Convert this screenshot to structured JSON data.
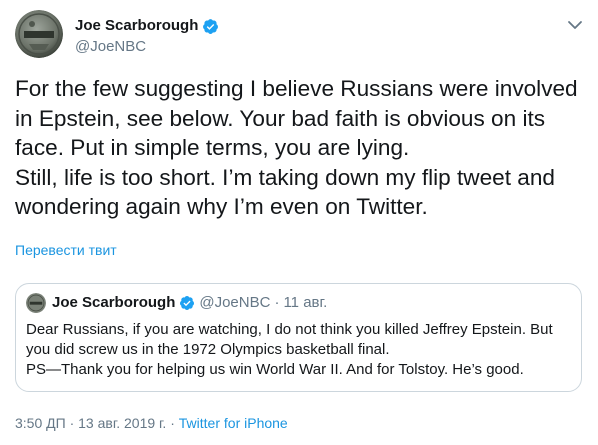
{
  "author": {
    "name": "Joe Scarborough",
    "handle": "@JoeNBC"
  },
  "tweet": {
    "lines": [
      "For the few suggesting I believe Russians were involved",
      "in Epstein, see below. Your bad faith is obvious on its",
      "face. Put in simple terms, you are lying.",
      "Still, life is too short. I’m taking down my flip tweet and",
      "wondering again why I’m even on Twitter."
    ],
    "translate_label": "Перевести твит"
  },
  "quoted_tweet": {
    "name": "Joe Scarborough",
    "handle": "@JoeNBC",
    "separator": "·",
    "date": "11 авг.",
    "lines": [
      "Dear Russians, if you are watching, I do not think you killed Jeffrey Epstein. But",
      "you did screw us in the 1972 Olympics basketball final.",
      "PS—Thank you for helping us win World War II. And for Tolstoy. He’s good."
    ]
  },
  "footer": {
    "time": "3:50 ДП",
    "separator1": "·",
    "date": "13 авг. 2019 г.",
    "separator2": "·",
    "source": "Twitter for iPhone"
  },
  "icons": {
    "verified": "verified-badge-icon",
    "caret": "chevron-down-icon"
  },
  "colors": {
    "accent": "#1b95e0",
    "secondary_text": "#657786",
    "border": "#ccd6dd"
  }
}
